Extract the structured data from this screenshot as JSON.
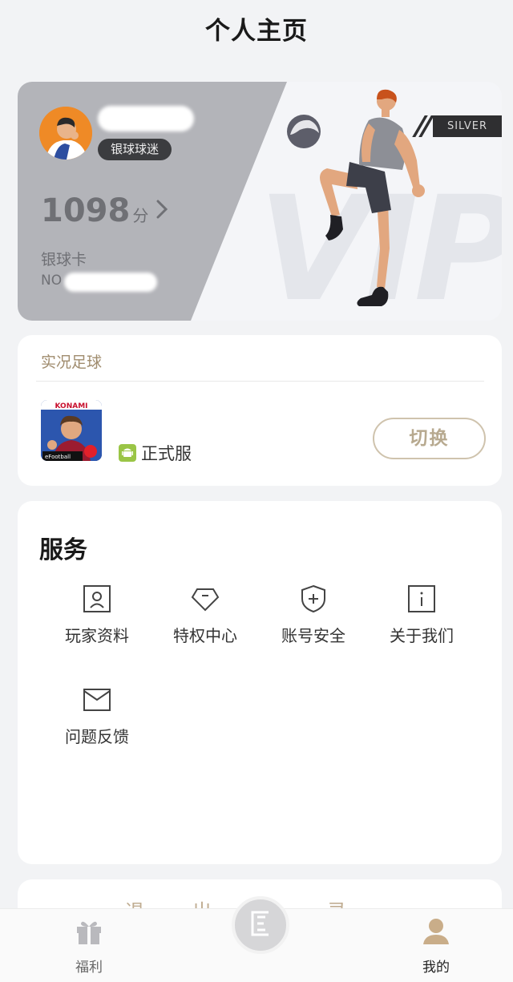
{
  "header": {
    "title": "个人主页"
  },
  "vip_card": {
    "rank": "银球球迷",
    "points": "1098",
    "points_unit": "分",
    "card_name": "银球卡",
    "card_no_prefix": "NO",
    "tier_badge": "SILVER",
    "watermark": "VIP",
    "colors": {
      "panel": "#b3b4b9",
      "badge": "#3b3c3f"
    }
  },
  "game": {
    "section_title": "实况足球",
    "app_brand": "KONAMI",
    "app_title": "eFootball",
    "server_label": "正式服",
    "switch_label": "切换"
  },
  "services": {
    "title": "服务",
    "items": [
      {
        "label": "玩家资料",
        "icon": "profile-card-icon"
      },
      {
        "label": "特权中心",
        "icon": "privilege-diamond-icon"
      },
      {
        "label": "账号安全",
        "icon": "shield-icon"
      },
      {
        "label": "关于我们",
        "icon": "info-icon"
      },
      {
        "label": "问题反馈",
        "icon": "envelope-icon"
      }
    ]
  },
  "logout": {
    "label": "退出登录"
  },
  "tabbar": {
    "items": [
      {
        "label": "福利",
        "icon": "gift-icon",
        "color": "#666666"
      },
      {
        "label": "我的",
        "icon": "user-icon",
        "color": "#222222"
      }
    ],
    "center_icon": "home-logo-icon",
    "accent": "#c9ad89"
  }
}
